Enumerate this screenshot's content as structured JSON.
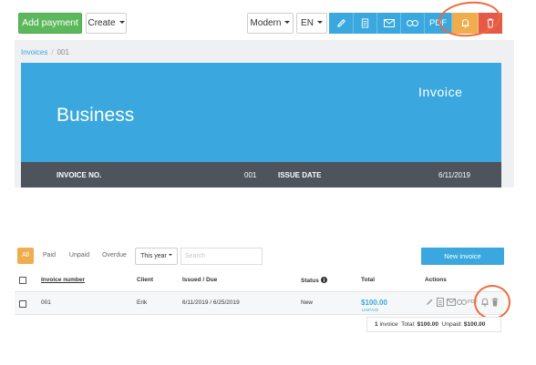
{
  "toolbar": {
    "add_payment": "Add payment",
    "create": "Create",
    "template": "Modern",
    "language": "EN",
    "pdf": "PDF",
    "tools": [
      "pencil-icon",
      "document-icon",
      "envelope-icon",
      "link-icon",
      "pdf-text",
      "bell-icon",
      "trash-icon"
    ],
    "colors": {
      "primary": "#3aa8de",
      "success": "#5cb85c",
      "warning": "#f0ad4e",
      "danger": "#e55a47",
      "annotation": "#ee6a3d"
    }
  },
  "breadcrumb": {
    "parent": "Invoices",
    "separator": "/",
    "current": "001"
  },
  "preview": {
    "title": "Invoice",
    "business": "Business",
    "invoice_no_label": "INVOICE NO.",
    "invoice_no_value": "001",
    "issue_date_label": "ISSUE DATE",
    "issue_date_value": "6/11/2019"
  },
  "filters": {
    "items": [
      "All",
      "Paid",
      "Unpaid",
      "Overdue"
    ],
    "active": "All"
  },
  "period": "This year",
  "search": {
    "placeholder": "Search",
    "value": ""
  },
  "new_invoice": "New invoice",
  "table": {
    "columns": {
      "number": "Invoice number",
      "client": "Client",
      "dates": "Issued / Due",
      "status": "Status",
      "total": "Total",
      "actions": "Actions"
    },
    "rows": [
      {
        "number": "001",
        "client": "Erik",
        "dates": "6/11/2019 / 6/25/2019",
        "status": "New",
        "total": "$100.00",
        "total_status": "UNPAID",
        "pdf": "PDF"
      }
    ]
  },
  "totals": {
    "count": "1",
    "count_label": "invoice",
    "total_label": "Total:",
    "total_value": "$100.00",
    "unpaid_label": "Unpaid:",
    "unpaid_value": "$100.00"
  }
}
